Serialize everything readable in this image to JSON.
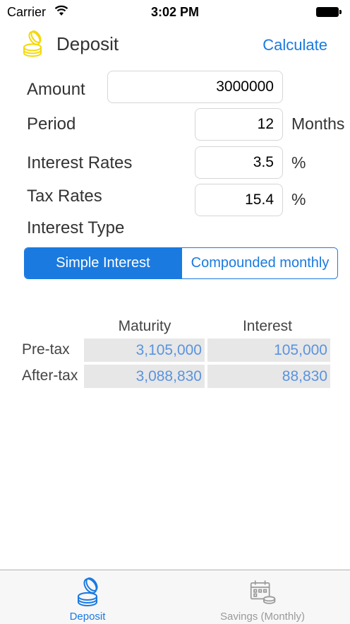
{
  "status_bar": {
    "carrier": "Carrier",
    "time": "3:02 PM"
  },
  "nav": {
    "title": "Deposit",
    "calculate_label": "Calculate"
  },
  "form": {
    "amount": {
      "label": "Amount",
      "value": "3000000"
    },
    "period": {
      "label": "Period",
      "value": "12",
      "unit": "Months"
    },
    "interest_rate": {
      "label": "Interest Rates",
      "value": "3.5",
      "unit": "%"
    },
    "tax_rate": {
      "label": "Tax Rates",
      "value": "15.4",
      "unit": "%"
    },
    "interest_type": {
      "label": "Interest Type",
      "options": [
        "Simple Interest",
        "Compounded monthly"
      ],
      "selected": "Simple Interest"
    }
  },
  "results": {
    "columns": [
      "Maturity",
      "Interest"
    ],
    "rows": [
      {
        "label": "Pre-tax",
        "maturity": "3,105,000",
        "interest": "105,000"
      },
      {
        "label": "After-tax",
        "maturity": "3,088,830",
        "interest": "88,830"
      }
    ]
  },
  "tabs": [
    {
      "label": "Deposit",
      "icon": "coins-icon",
      "active": true
    },
    {
      "label": "Savings (Monthly)",
      "icon": "calendar-coins-icon",
      "active": false
    }
  ],
  "colors": {
    "accent": "#1a7ae0",
    "result_text": "#5a93de",
    "result_bg": "#e7e7e7",
    "coin_icon": "#f3d90b"
  }
}
